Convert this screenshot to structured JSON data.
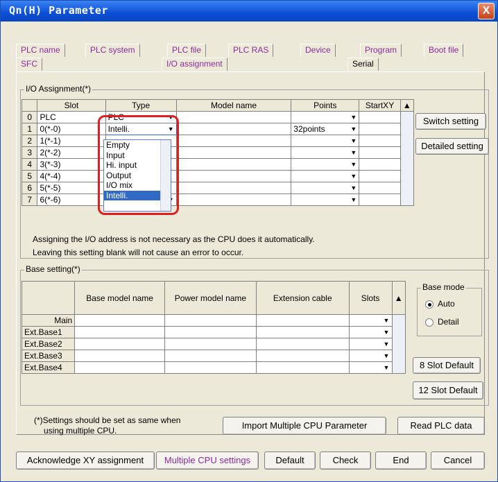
{
  "window": {
    "title": "Qn(H) Parameter",
    "close": "X"
  },
  "tabs_row1": [
    "PLC name",
    "PLC system",
    "PLC file",
    "PLC RAS",
    "Device",
    "Program",
    "Boot file"
  ],
  "tabs_row2": [
    "SFC",
    "I/O assignment",
    "Serial"
  ],
  "io": {
    "group_title": "I/O Assignment(*)",
    "headers": [
      "Slot",
      "Type",
      "Model name",
      "Points",
      "StartXY"
    ],
    "rows": [
      {
        "num": "0",
        "slot": "PLC",
        "type": "PLC",
        "points": ""
      },
      {
        "num": "1",
        "slot": "0(*-0)",
        "type": "Intelli.",
        "points": "32points"
      },
      {
        "num": "2",
        "slot": "1(*-1)",
        "type": "",
        "points": ""
      },
      {
        "num": "3",
        "slot": "2(*-2)",
        "type": "",
        "points": ""
      },
      {
        "num": "4",
        "slot": "3(*-3)",
        "type": "",
        "points": ""
      },
      {
        "num": "5",
        "slot": "4(*-4)",
        "type": "",
        "points": ""
      },
      {
        "num": "6",
        "slot": "5(*-5)",
        "type": "",
        "points": ""
      },
      {
        "num": "7",
        "slot": "6(*-6)",
        "type": "",
        "points": ""
      }
    ],
    "dropdown_options": [
      "Empty",
      "Input",
      "Hi. input",
      "Output",
      "I/O mix",
      "Intelli."
    ],
    "switch_setting": "Switch setting",
    "detailed_setting": "Detailed setting",
    "note1": "Assigning the I/O address is not necessary as the CPU does it automatically.",
    "note2": "Leaving this setting blank will not cause an error to occur."
  },
  "base": {
    "group_title": "Base setting(*)",
    "headers": [
      "Base model name",
      "Power model name",
      "Extension cable",
      "Slots"
    ],
    "rows": [
      "Main",
      "Ext.Base1",
      "Ext.Base2",
      "Ext.Base3",
      "Ext.Base4"
    ],
    "mode_title": "Base mode",
    "mode_auto": "Auto",
    "mode_detail": "Detail",
    "slot8": "8 Slot Default",
    "slot12": "12 Slot Default"
  },
  "footer": {
    "note_line1": "(*)Settings should be set as same when",
    "note_line2": "using multiple CPU.",
    "import_btn": "Import Multiple CPU Parameter",
    "read_btn": "Read PLC data",
    "ack_btn": "Acknowledge XY assignment",
    "multi_btn": "Multiple CPU settings",
    "default_btn": "Default",
    "check_btn": "Check",
    "end_btn": "End",
    "cancel_btn": "Cancel"
  }
}
